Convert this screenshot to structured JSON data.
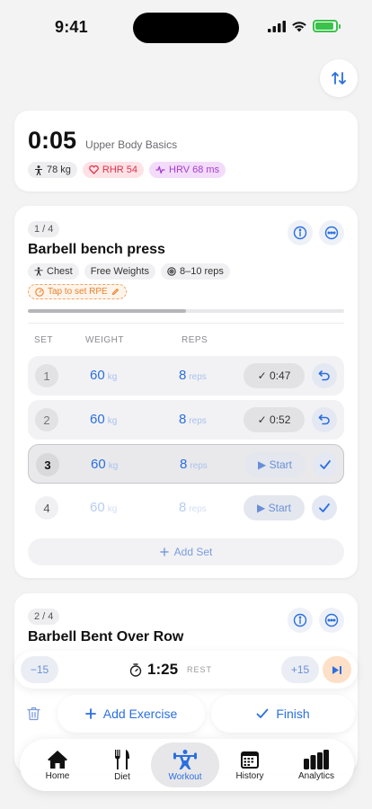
{
  "status": {
    "time": "9:41"
  },
  "header": {
    "sort_icon": "arrows-up-down-icon"
  },
  "session": {
    "elapsed": "0:05",
    "name": "Upper Body Basics",
    "chips": {
      "weight": "78 kg",
      "rhr": "RHR 54",
      "hrv": "HRV 68 ms"
    }
  },
  "exercises": [
    {
      "badge": "1 / 4",
      "title": "Barbell bench press",
      "tags": {
        "muscle": "Chest",
        "equipment": "Free Weights",
        "rep_range": "8–10 reps"
      },
      "rpe_prompt": "Tap to set RPE",
      "progress": 0.5,
      "columns": {
        "set": "SET",
        "weight": "WEIGHT",
        "reps": "REPS"
      },
      "sets": [
        {
          "num": "1",
          "weight": "60",
          "weight_unit": "kg",
          "reps": "8",
          "reps_unit": "reps",
          "action": "✓ 0:47",
          "state": "done"
        },
        {
          "num": "2",
          "weight": "60",
          "weight_unit": "kg",
          "reps": "8",
          "reps_unit": "reps",
          "action": "✓ 0:52",
          "state": "done"
        },
        {
          "num": "3",
          "weight": "60",
          "weight_unit": "kg",
          "reps": "8",
          "reps_unit": "reps",
          "action": "▶ Start",
          "state": "active"
        },
        {
          "num": "4",
          "weight": "60",
          "weight_unit": "kg",
          "reps": "8",
          "reps_unit": "reps",
          "action": "▶ Start",
          "state": "pending"
        }
      ],
      "add_set": "Add Set"
    },
    {
      "badge": "2 / 4",
      "title": "Barbell Bent Over Row"
    }
  ],
  "rest": {
    "minus": "−15",
    "time": "1:25",
    "label": "REST",
    "plus": "+15"
  },
  "actions": {
    "add_exercise": "Add Exercise",
    "finish": "Finish"
  },
  "tabs": [
    {
      "label": "Home",
      "icon": "house-icon"
    },
    {
      "label": "Diet",
      "icon": "fork-knife-icon"
    },
    {
      "label": "Workout",
      "icon": "weightlifter-icon",
      "active": true
    },
    {
      "label": "History",
      "icon": "calendar-icon"
    },
    {
      "label": "Analytics",
      "icon": "bar-chart-icon"
    }
  ],
  "colors": {
    "accent": "#2a6fe0",
    "rhr": "#e0324b",
    "hrv": "#a43ed0",
    "rpe": "#e8822e",
    "battery": "#3ac24a"
  }
}
